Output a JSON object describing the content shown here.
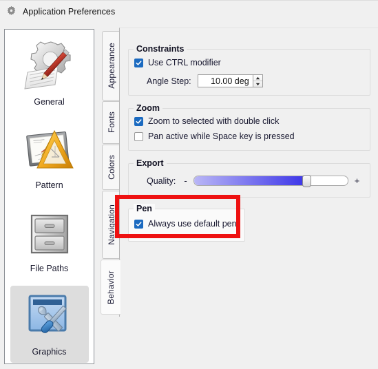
{
  "window": {
    "title": "Application Preferences",
    "title_icon": "gear-icon"
  },
  "sidebar": {
    "items": [
      {
        "label": "General",
        "icon": "gear-pencil-paper-icon",
        "selected": false
      },
      {
        "label": "Pattern",
        "icon": "drawing-board-triangle-icon",
        "selected": false
      },
      {
        "label": "File Paths",
        "icon": "filing-cabinet-icon",
        "selected": false
      },
      {
        "label": "Graphics",
        "icon": "window-tools-icon",
        "selected": true
      }
    ]
  },
  "tabs": {
    "items": [
      {
        "label": "Appearance",
        "active": false
      },
      {
        "label": "Fonts",
        "active": false
      },
      {
        "label": "Colors",
        "active": false
      },
      {
        "label": "Navigation",
        "active": false
      },
      {
        "label": "Behavior",
        "active": true
      }
    ]
  },
  "groups": {
    "constraints": {
      "title": "Constraints",
      "use_ctrl_modifier": {
        "label": "Use CTRL modifier",
        "checked": true
      },
      "angle_step": {
        "label": "Angle Step:",
        "value": "10.00 deg"
      }
    },
    "zoom": {
      "title": "Zoom",
      "zoom_double_click": {
        "label": "Zoom to selected with double click",
        "checked": true
      },
      "pan_space": {
        "label": "Pan active while Space key is pressed",
        "checked": false
      }
    },
    "export": {
      "title": "Export",
      "quality": {
        "label": "Quality:",
        "minus": "-",
        "plus": "+",
        "percent": 73
      }
    },
    "pen": {
      "title": "Pen",
      "always_default_pen": {
        "label": "Always use default pen",
        "checked": true
      }
    }
  },
  "annotation": {
    "color": "#ee1111",
    "target": "pen-group"
  }
}
